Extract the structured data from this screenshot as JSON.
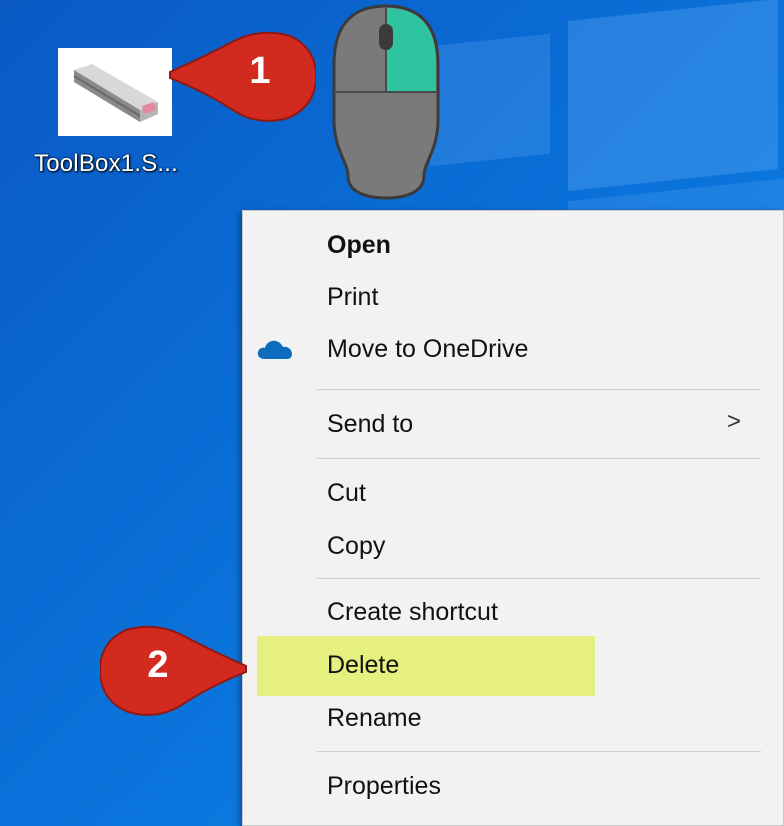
{
  "desktop": {
    "file": {
      "name": "ToolBox1.S...",
      "icon": "part-file-icon"
    }
  },
  "callouts": [
    {
      "number": "1",
      "color": "#d32a20"
    },
    {
      "number": "2",
      "color": "#d32a20"
    }
  ],
  "mouse": {
    "icon": "mouse-right-click-icon",
    "highlight_color": "#2ec4a0"
  },
  "context_menu": {
    "items": [
      {
        "label": "Open",
        "bold": true
      },
      {
        "label": "Print"
      },
      {
        "label": "Move to OneDrive",
        "icon": "onedrive-cloud-icon"
      },
      {
        "label": "Send to",
        "submenu_arrow": ">"
      },
      {
        "label": "Cut"
      },
      {
        "label": "Copy"
      },
      {
        "label": "Create shortcut"
      },
      {
        "label": "Delete",
        "highlighted": true,
        "highlight_color": "#e6f07e"
      },
      {
        "label": "Rename"
      },
      {
        "label": "Properties"
      }
    ]
  }
}
